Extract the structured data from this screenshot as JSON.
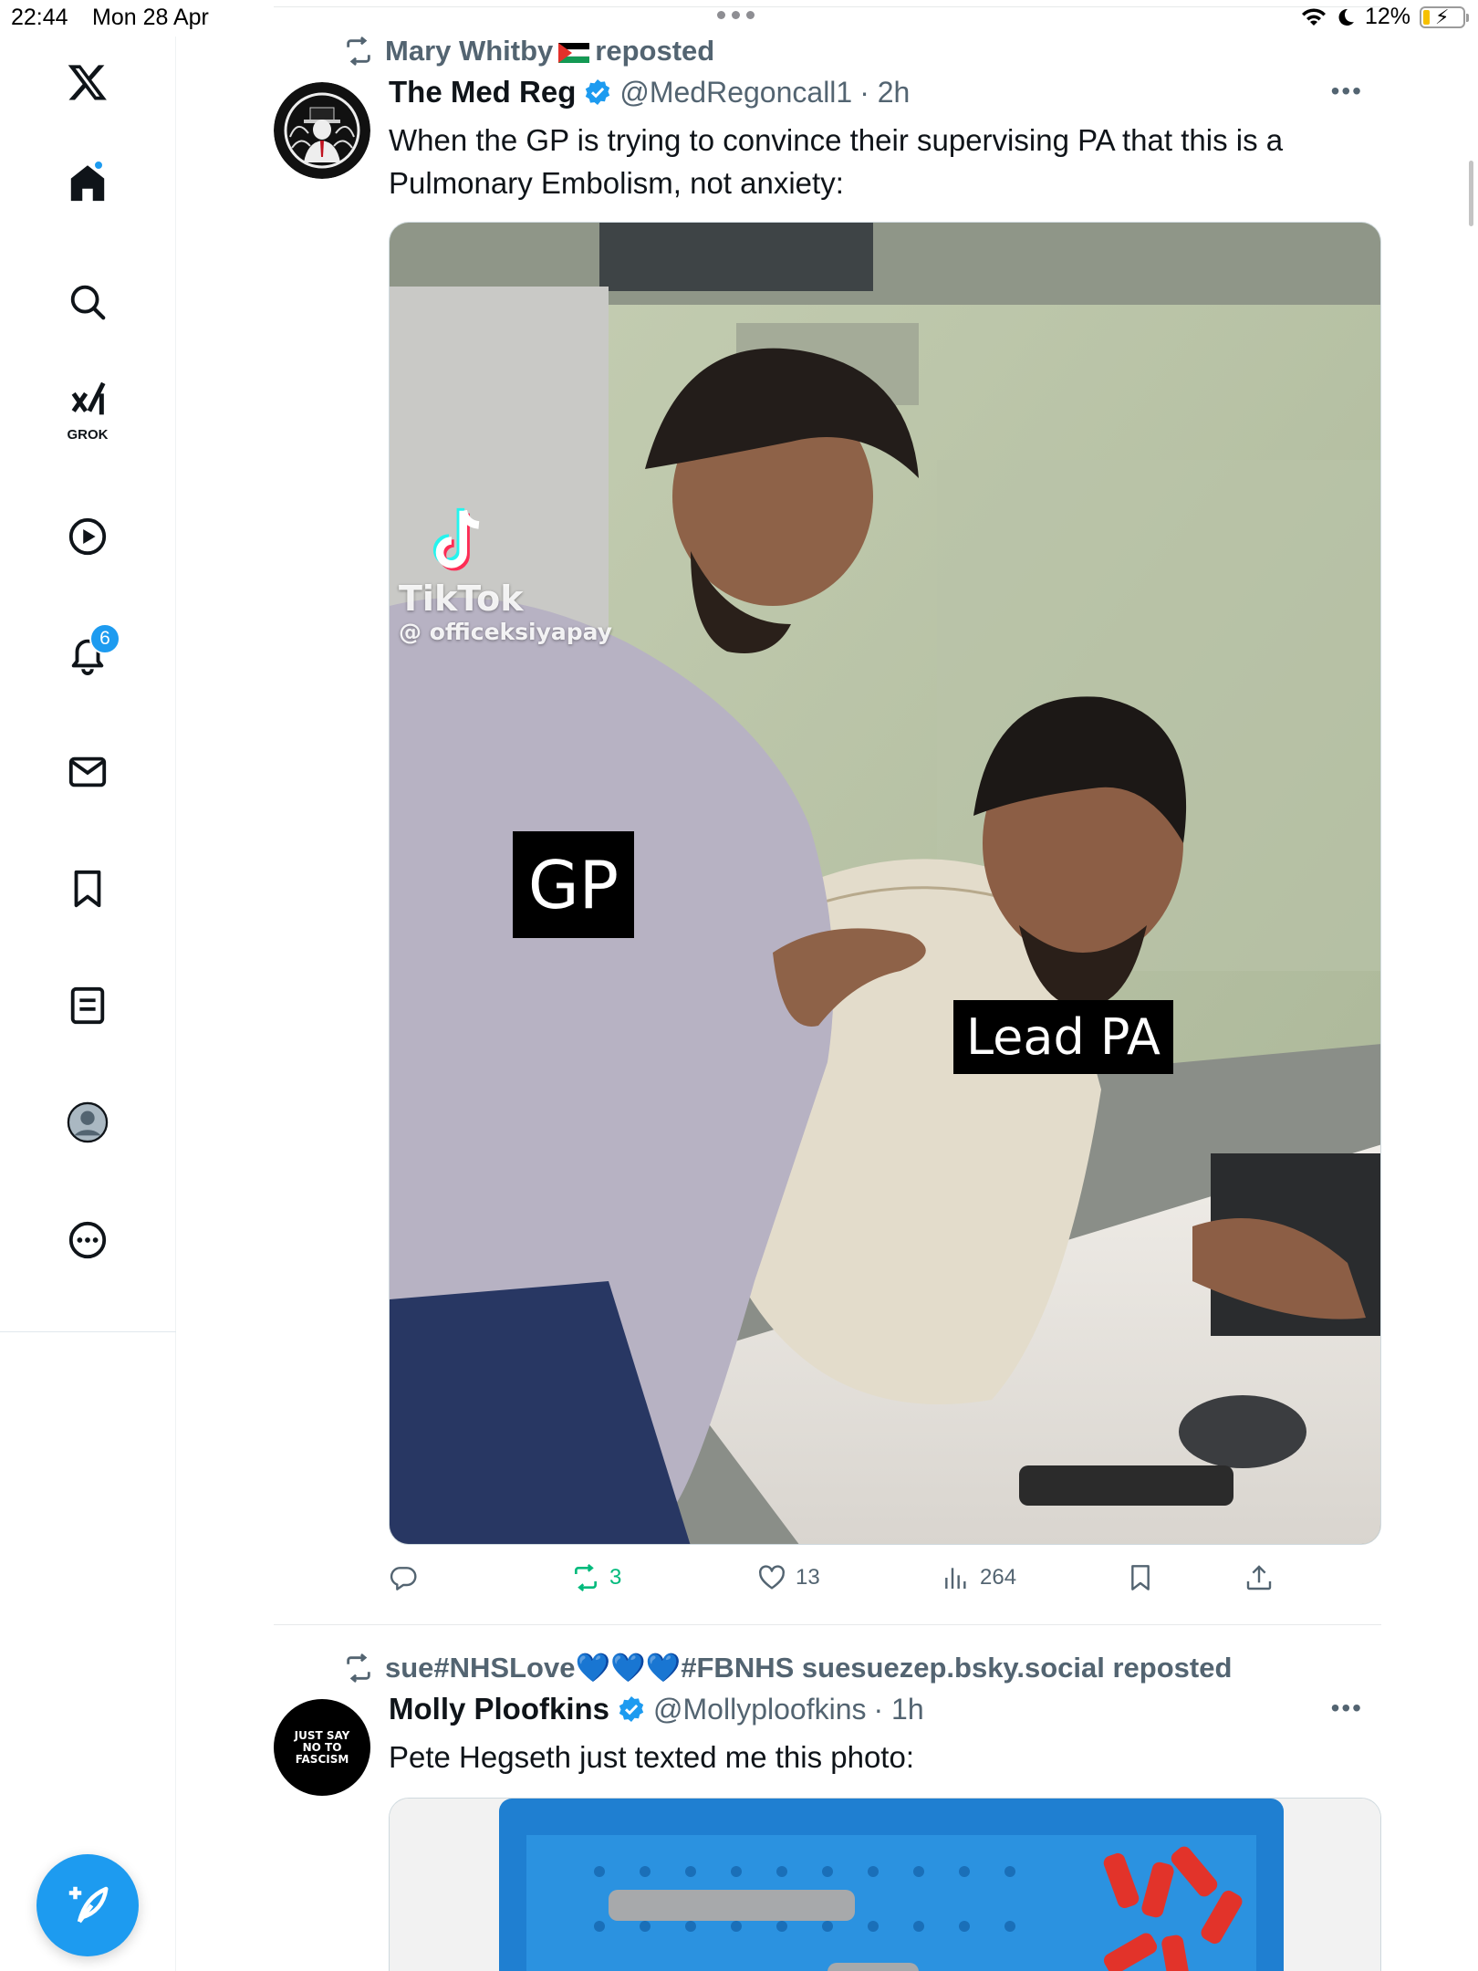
{
  "status_bar": {
    "time": "22:44",
    "date": "Mon 28 Apr",
    "battery": "12%"
  },
  "sidebar": {
    "items": [
      {
        "name": "x-logo",
        "label": ""
      },
      {
        "name": "home",
        "label": ""
      },
      {
        "name": "explore",
        "label": ""
      },
      {
        "name": "grok",
        "label": "GROK"
      },
      {
        "name": "videos",
        "label": ""
      },
      {
        "name": "notifications",
        "label": "",
        "badge": "6"
      },
      {
        "name": "messages",
        "label": ""
      },
      {
        "name": "bookmarks",
        "label": ""
      },
      {
        "name": "lists",
        "label": ""
      },
      {
        "name": "profile",
        "label": ""
      },
      {
        "name": "more",
        "label": ""
      }
    ]
  },
  "timeline": {
    "tweets": [
      {
        "repost_by": "Mary Whitby",
        "repost_flag": "palestine-flag",
        "repost_suffix": "reposted",
        "display_name": "The Med Reg",
        "handle": "@MedRegoncall1",
        "time": "· 2h",
        "text": "When the GP is trying to convince their supervising PA that this is a Pulmonary Embolism, not anxiety:",
        "media": {
          "watermark_brand": "TikTok",
          "watermark_user": "@ officeksiyapay",
          "label_left": "GP",
          "label_right": "Lead PA"
        },
        "reply_count": "",
        "repost_count": "3",
        "like_count": "13",
        "view_count": "264"
      },
      {
        "repost_by": "sue#NHSLove💙💙💙#FBNHS suesuezep.bsky.social reposted",
        "display_name": "Molly Ploofkins",
        "handle": "@Mollyploofkins",
        "time": "· 1h",
        "avatar_text": "JUST SAY NO TO FASCISM",
        "text": "Pete Hegseth just texted me this photo:"
      }
    ]
  },
  "colors": {
    "accent": "#1d9bf0",
    "repost_green": "#00ba7c",
    "muted": "#536471",
    "text": "#0f1419"
  }
}
